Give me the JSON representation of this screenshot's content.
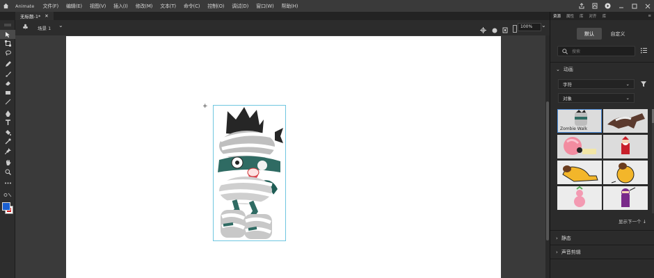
{
  "app": {
    "name": "Animate"
  },
  "menu": {
    "items": [
      "文件(F)",
      "编辑(E)",
      "视图(V)",
      "插入(I)",
      "修改(M)",
      "文本(T)",
      "命令(C)",
      "控制(O)",
      "调试(D)",
      "窗口(W)",
      "帮助(H)"
    ]
  },
  "document": {
    "tab_title": "无标题-1*"
  },
  "scene": {
    "label": "场景 1"
  },
  "zoom": {
    "value": "100%"
  },
  "panel": {
    "tabs": [
      "资源",
      "属性",
      "库",
      "对齐",
      "库"
    ],
    "segments": [
      "默认",
      "自定义"
    ],
    "search_placeholder": "搜索",
    "section_anim": "动画",
    "filter1": "字符",
    "filter2": "对象",
    "assets": [
      {
        "name": "Zombie Walk",
        "icon": "mummy-character"
      },
      {
        "name": "",
        "icon": "werewolf-character"
      },
      {
        "name": "",
        "icon": "pink-creature-character"
      },
      {
        "name": "",
        "icon": "santa-character"
      },
      {
        "name": "",
        "icon": "yellow-dog-character"
      },
      {
        "name": "",
        "icon": "yellow-dog-sitting-character"
      },
      {
        "name": "",
        "icon": "pink-pig-character"
      },
      {
        "name": "",
        "icon": "purple-ninja-character"
      }
    ],
    "show_more": "显示下一个",
    "section_static": "静态",
    "section_sound": "声音剪辑"
  },
  "colors": {
    "stroke": "#ffffff",
    "fill": "#1a5fd0",
    "accent": "#4d8edb"
  }
}
